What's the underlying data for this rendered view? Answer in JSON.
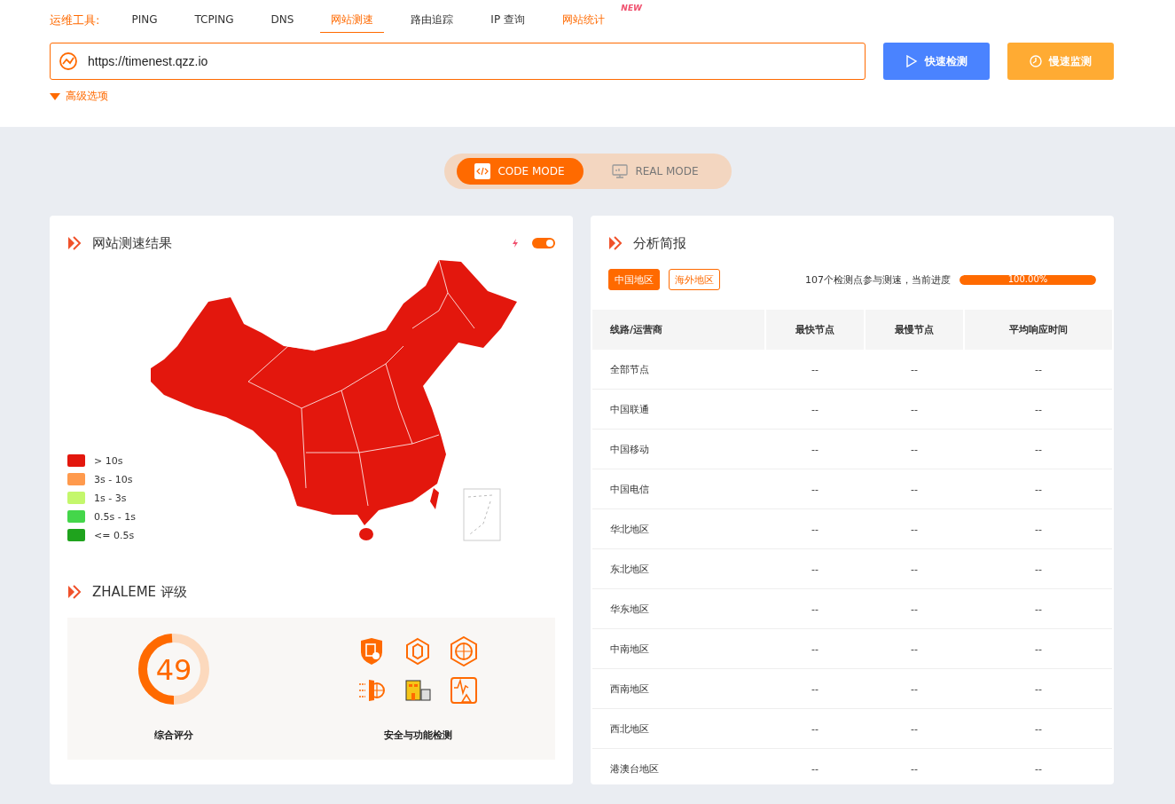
{
  "tools": {
    "label": "运维工具:",
    "items": [
      {
        "label": "PING",
        "selected": false
      },
      {
        "label": "TCPING",
        "selected": false
      },
      {
        "label": "DNS",
        "selected": false
      },
      {
        "label": "网站测速",
        "selected": true
      },
      {
        "label": "路由追踪",
        "selected": false
      },
      {
        "label": "IP 查询",
        "selected": false
      },
      {
        "label": "网站统计",
        "selected": false,
        "kind": "highlight",
        "badge": "NEW"
      }
    ]
  },
  "url_field": {
    "value": "https://timenest.qzz.io"
  },
  "buttons": [
    {
      "kind": "quick",
      "label": "快速检测"
    },
    {
      "kind": "slow",
      "label": "慢速监测"
    }
  ],
  "advanced": {
    "label": "高级选项"
  },
  "modes": [
    {
      "kind": "code",
      "label": "CODE MODE",
      "selected": true
    },
    {
      "kind": "real",
      "label": "REAL MODE",
      "selected": false
    }
  ],
  "speed_card": {
    "title": "网站测速结果",
    "toggle_on": true,
    "legend": [
      {
        "label": "> 10s",
        "color": "#e3170d"
      },
      {
        "label": "3s - 10s",
        "color": "#ff9a4d"
      },
      {
        "label": "1s - 3s",
        "color": "#c4f76c"
      },
      {
        "label": "0.5s - 1s",
        "color": "#44d64a"
      },
      {
        "label": "<= 0.5s",
        "color": "#1fa31d"
      }
    ]
  },
  "rating": {
    "title": "ZHALEME 评级",
    "score": "49",
    "level": 0.49,
    "score_label": "综合评分",
    "checks_label": "安全与功能检测"
  },
  "analysis": {
    "title": "分析简报",
    "regions": [
      {
        "label": "中国地区",
        "selected": true
      },
      {
        "label": "海外地区",
        "selected": false
      }
    ],
    "summary": "107个检测点参与测速，当前进度",
    "progress": {
      "level": 1,
      "label": "100.00%"
    },
    "table": {
      "columns": [
        "线路/运营商",
        "最快节点",
        "最慢节点",
        "平均响应时间"
      ],
      "rows": [
        [
          "全部节点",
          "--",
          "--",
          "--"
        ],
        [
          "中国联通",
          "--",
          "--",
          "--"
        ],
        [
          "中国移动",
          "--",
          "--",
          "--"
        ],
        [
          "中国电信",
          "--",
          "--",
          "--"
        ],
        [
          "华北地区",
          "--",
          "--",
          "--"
        ],
        [
          "东北地区",
          "--",
          "--",
          "--"
        ],
        [
          "华东地区",
          "--",
          "--",
          "--"
        ],
        [
          "中南地区",
          "--",
          "--",
          "--"
        ],
        [
          "西南地区",
          "--",
          "--",
          "--"
        ],
        [
          "西北地区",
          "--",
          "--",
          "--"
        ],
        [
          "港澳台地区",
          "--",
          "--",
          "--"
        ]
      ]
    }
  }
}
